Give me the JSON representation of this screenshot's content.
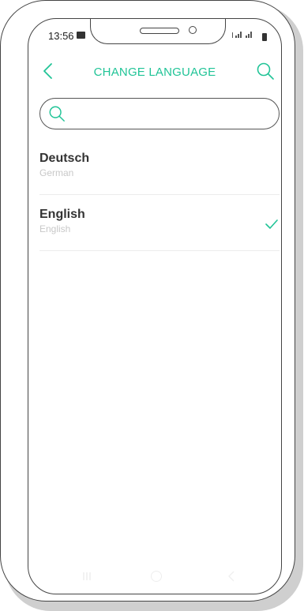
{
  "status_bar": {
    "time": "13:56",
    "signal_text": "⊘ 4G .ıl 4G .ıl",
    "icons": [
      "image-icon",
      "signal-icon",
      "battery-icon"
    ]
  },
  "header": {
    "title": "CHANGE LANGUAGE",
    "back_icon": "chevron-left-icon",
    "search_icon": "search-icon"
  },
  "search": {
    "placeholder": "",
    "value": ""
  },
  "languages": [
    {
      "name": "Deutsch",
      "native": "German",
      "selected": false
    },
    {
      "name": "English",
      "native": "English",
      "selected": true
    }
  ],
  "colors": {
    "accent": "#21c497",
    "text": "#333333",
    "subtext": "#c8c8c8"
  }
}
